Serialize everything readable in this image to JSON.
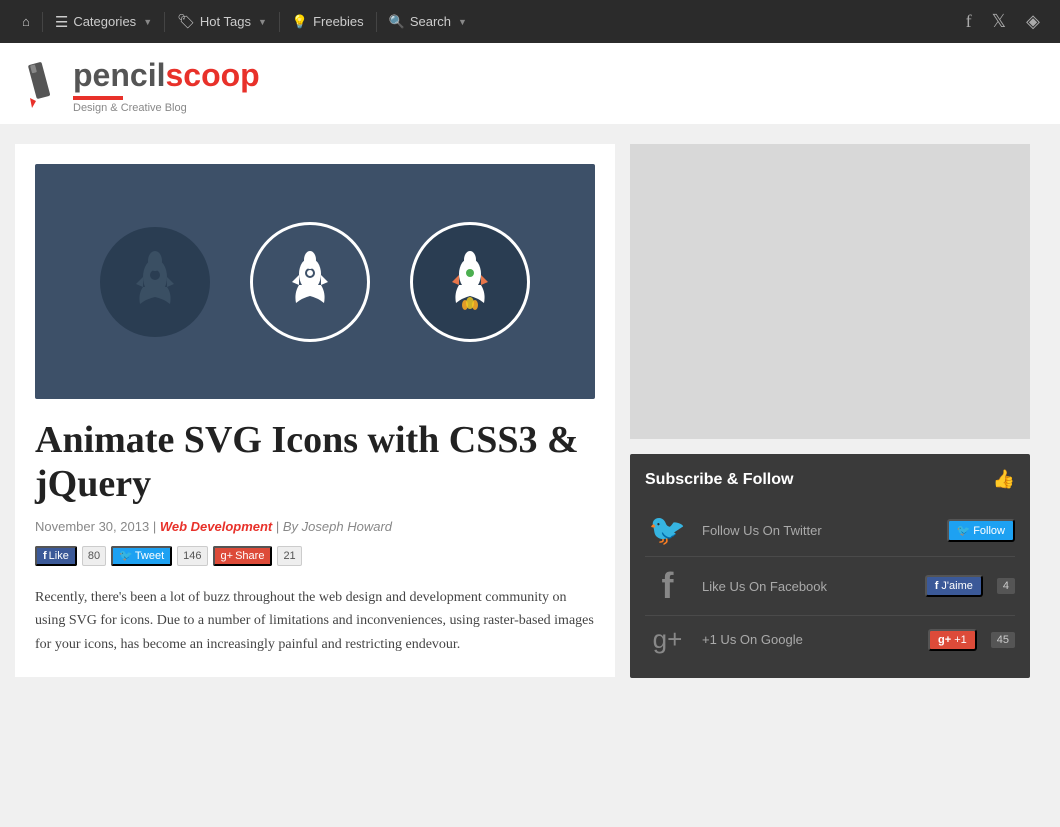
{
  "nav": {
    "home_icon": "⌂",
    "categories_label": "Categories",
    "hottags_label": "Hot Tags",
    "freebies_label": "Freebies",
    "search_label": "Search"
  },
  "header": {
    "logo_pencil": "pencil",
    "logo_scoop": "scoop",
    "tagline": "Design & Creative Blog"
  },
  "article": {
    "title": "Animate SVG Icons with CSS3 & jQuery",
    "date": "November 30, 2013",
    "category": "Web Development",
    "author": "By Joseph Howard",
    "body": "Recently, there's been a lot of buzz throughout the web design and development community on using SVG for icons. Due to a number of limitations and inconveniences, using raster-based images for your icons, has become an increasingly painful and restricting endevour.",
    "fb_label": "Like",
    "fb_count": "80",
    "tweet_label": "Tweet",
    "tweet_count": "146",
    "share_label": "Share",
    "share_count": "21"
  },
  "subscribe": {
    "title": "Subscribe & Follow",
    "twitter_label": "Follow Us On Twitter",
    "twitter_btn": "Follow",
    "facebook_label": "Like Us On Facebook",
    "facebook_btn": "J'aime",
    "facebook_count": "4",
    "gplus_label": "+1 Us On Google",
    "gplus_btn": "+1",
    "gplus_count": "45"
  }
}
